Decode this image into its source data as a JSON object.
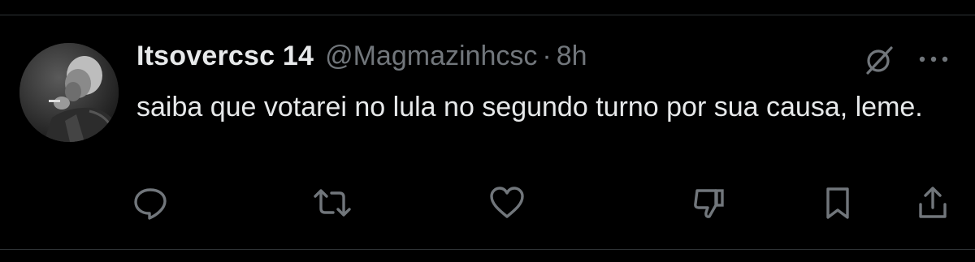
{
  "tweet": {
    "display_name": "Itsovercsc 14",
    "handle": "@Magmazinhcsc",
    "separator": "·",
    "time": "8h",
    "text": "saiba que votarei no lula no segundo turno por sua causa, leme."
  },
  "icons": {
    "avatar": "avatar-photo",
    "grok": "grok-icon",
    "more": "more-icon",
    "reply": "reply-icon",
    "retweet": "retweet-icon",
    "like": "like-icon",
    "dislike": "dislike-icon",
    "bookmark": "bookmark-icon",
    "share": "share-icon"
  },
  "colors": {
    "background": "#000000",
    "primary_text": "#e7e9ea",
    "secondary_text": "#71767b",
    "divider": "#2f3336"
  }
}
